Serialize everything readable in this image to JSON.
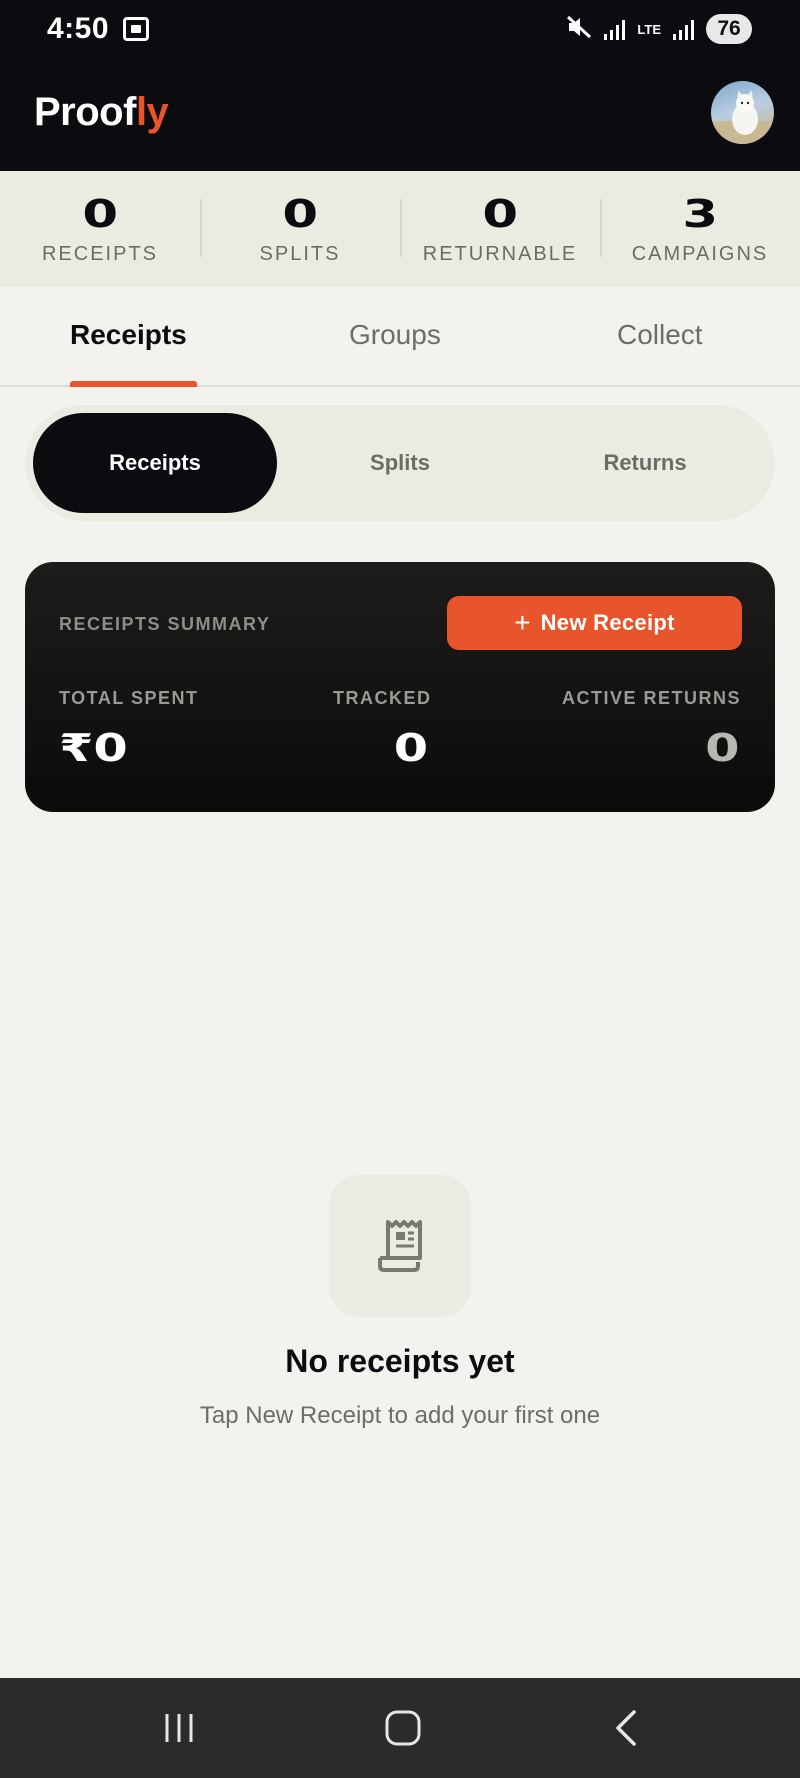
{
  "status_bar": {
    "time": "4:50",
    "network": "LTE",
    "battery": "76",
    "icons": [
      "screen-record-icon",
      "mute-icon",
      "signal-icon",
      "signal-icon"
    ]
  },
  "header": {
    "logo_main": "Proof",
    "logo_accent": "ly",
    "avatar_icon": "profile-avatar"
  },
  "stats": [
    {
      "value": "0",
      "label": "RECEIPTS"
    },
    {
      "value": "0",
      "label": "SPLITS"
    },
    {
      "value": "0",
      "label": "RETURNABLE"
    },
    {
      "value": "3",
      "label": "CAMPAIGNS"
    }
  ],
  "tabs": [
    {
      "label": "Receipts",
      "active": true
    },
    {
      "label": "Groups",
      "active": false
    },
    {
      "label": "Collect",
      "active": false
    }
  ],
  "segments": [
    {
      "label": "Receipts",
      "active": true
    },
    {
      "label": "Splits",
      "active": false
    },
    {
      "label": "Returns",
      "active": false
    }
  ],
  "summary": {
    "title": "RECEIPTS SUMMARY",
    "new_button": {
      "icon": "+",
      "label": "New Receipt"
    },
    "metrics": [
      {
        "label": "TOTAL SPENT",
        "value": "₹0"
      },
      {
        "label": "TRACKED",
        "value": "0"
      },
      {
        "label": "ACTIVE RETURNS",
        "value": "0"
      }
    ]
  },
  "empty_state": {
    "icon": "receipt-icon",
    "title": "No receipts yet",
    "subtitle": "Tap New Receipt to add your first one"
  },
  "nav": {
    "icons": [
      "recent-apps-icon",
      "home-icon",
      "back-icon"
    ]
  },
  "colors": {
    "accent": "#e8542b",
    "dark": "#0b0b10",
    "background": "#f4f2ee",
    "strip": "#ecebe1"
  }
}
